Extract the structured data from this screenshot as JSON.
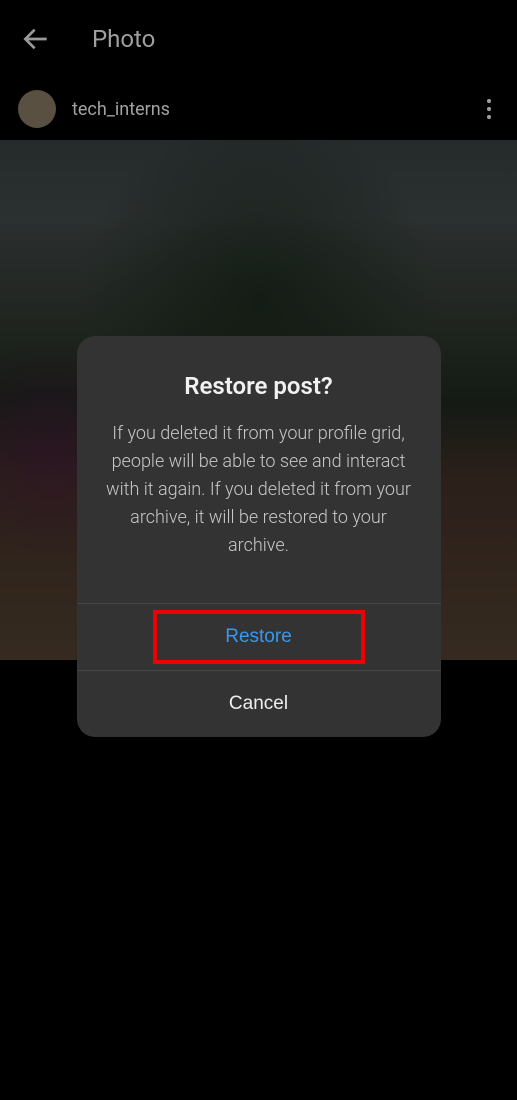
{
  "header": {
    "title": "Photo"
  },
  "post": {
    "username": "tech_interns"
  },
  "modal": {
    "title": "Restore post?",
    "body": "If you deleted it from your profile grid, people will be able to see and interact with it again. If you deleted it from your archive, it will be restored to your archive.",
    "restore_label": "Restore",
    "cancel_label": "Cancel"
  }
}
